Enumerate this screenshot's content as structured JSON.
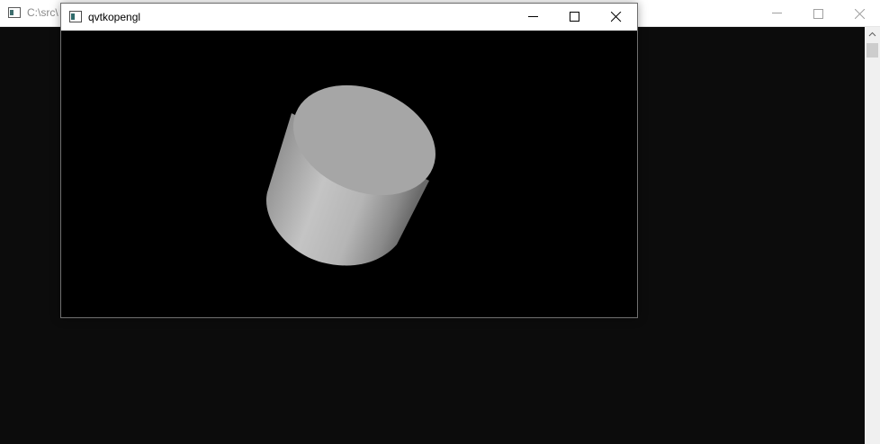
{
  "background_window": {
    "title": "C:\\src\\",
    "controls": {
      "minimize_icon": "minimize-icon",
      "maximize_icon": "maximize-icon",
      "close_icon": "close-icon"
    }
  },
  "app_window": {
    "title": "qvtkopengl",
    "controls": {
      "minimize_icon": "minimize-icon",
      "maximize_icon": "maximize-icon",
      "close_icon": "close-icon"
    },
    "render_view": {
      "background_color": "#000000",
      "object": "cylinder",
      "object_color": "#b0b0b0"
    }
  }
}
